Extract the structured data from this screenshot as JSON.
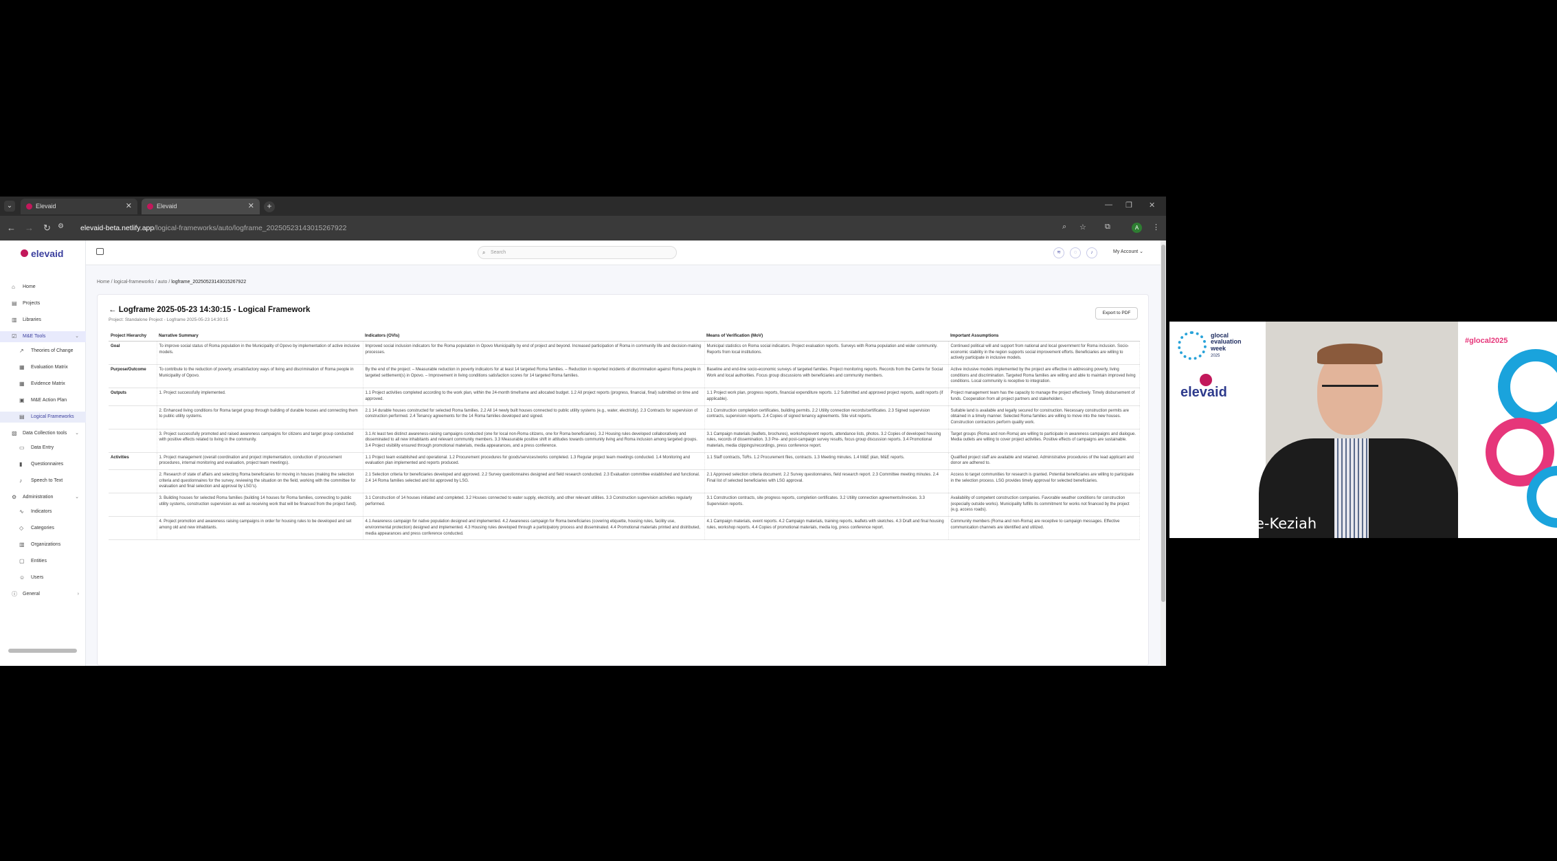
{
  "browser": {
    "tabs": [
      {
        "label": "Elevaid"
      },
      {
        "label": "Elevaid"
      }
    ],
    "url_host": "elevaid-beta.netlify.app",
    "url_path": "/logical-frameworks/auto/logframe_20250523143015267922",
    "profile_initial": "A"
  },
  "app": {
    "logo": "elevaid",
    "search_placeholder": "Search",
    "account_label": "My Account",
    "sidebar": {
      "home": "Home",
      "projects": "Projects",
      "libraries": "Libraries",
      "me_tools": "M&E Tools",
      "theories": "Theories of Change",
      "eval_matrix": "Evaluation Matrix",
      "evidence_matrix": "Evidence Matrix",
      "action_plan": "M&E Action Plan",
      "logical_frameworks": "Logical Frameworks",
      "data_tools": "Data Collection tools",
      "data_entry": "Data Entry",
      "questionnaires": "Questionnaires",
      "speech_to_text": "Speech to Text",
      "administration": "Administration",
      "indicators": "Indicators",
      "categories": "Categories",
      "organizations": "Organizations",
      "entities": "Entities",
      "users": "Users",
      "general": "General"
    },
    "breadcrumb": {
      "home": "Home",
      "sep": "/",
      "lf": "logical-frameworks",
      "auto": "auto",
      "current": "logframe_20250523143015267922"
    },
    "page": {
      "title": "Logframe 2025-05-23 14:30:15 - Logical Framework",
      "subtitle": "Project: Standalone Project - Logframe 2025-05-23 14:30:15",
      "export_label": "Export to PDF"
    },
    "table": {
      "headers": [
        "Project Hierarchy",
        "Narrative Summary",
        "Indicators (OVIs)",
        "Means of Verification (MoV)",
        "Important Assumptions"
      ],
      "rows": [
        {
          "level": "Goal",
          "narrative": "To improve social status of Roma population in the Municipality of Opovo by implementation of active inclusive models.",
          "indicators": "Improved social inclusion indicators for the Roma population in Opovo Municipality by end of project and beyond. Increased participation of Roma in community life and decision-making processes.",
          "mov": "Municipal statistics on Roma social indicators. Project evaluation reports. Surveys with Roma population and wider community. Reports from local institutions.",
          "assumptions": "Continued political will and support from national and local government for Roma inclusion. Socio-economic stability in the region supports social improvement efforts. Beneficiaries are willing to actively participate in inclusive models."
        },
        {
          "level": "Purpose/Outcome",
          "narrative": "To contribute to the reduction of poverty, unsatisfactory ways of living and discrimination of Roma people in Municipality of Opovo.",
          "indicators": "By the end of the project: – Measurable reduction in poverty indicators for at least 14 targeted Roma families. – Reduction in reported incidents of discrimination against Roma people in targeted settlement(s) in Opovo. – Improvement in living conditions satisfaction scores for 14 targeted Roma families.",
          "mov": "Baseline and end-line socio-economic surveys of targeted families. Project monitoring reports. Records from the Centre for Social Work and local authorities. Focus group discussions with beneficiaries and community members.",
          "assumptions": "Active inclusive models implemented by the project are effective in addressing poverty, living conditions and discrimination. Targeted Roma families are willing and able to maintain improved living conditions. Local community is receptive to integration."
        },
        {
          "level": "Outputs",
          "narrative": "1. Project successfully implemented.",
          "indicators": "1.1 Project activities completed according to the work plan, within the 24-month timeframe and allocated budget. 1.2 All project reports (progress, financial, final) submitted on time and approved.",
          "mov": "1.1 Project work plan, progress reports, financial expenditure reports. 1.2 Submitted and approved project reports, audit reports (if applicable).",
          "assumptions": "Project management team has the capacity to manage the project effectively. Timely disbursement of funds. Cooperation from all project partners and stakeholders."
        },
        {
          "level": "",
          "narrative": "2. Enhanced living conditions for Roma target group through building of durable houses and connecting them to public utility systems.",
          "indicators": "2.1 14 durable houses constructed for selected Roma families. 2.2 All 14 newly built houses connected to public utility systems (e.g., water, electricity). 2.3 Contracts for supervision of construction performed. 2.4 Tenancy agreements for the 14 Roma families developed and signed.",
          "mov": "2.1 Construction completion certificates, building permits. 2.2 Utility connection records/certificates. 2.3 Signed supervision contracts, supervision reports. 2.4 Copies of signed tenancy agreements. Site visit reports.",
          "assumptions": "Suitable land is available and legally secured for construction. Necessary construction permits are obtained in a timely manner. Selected Roma families are willing to move into the new houses. Construction contractors perform quality work."
        },
        {
          "level": "",
          "narrative": "3. Project successfully promoted and raised awareness campaigns for citizens and target group conducted with positive effects related to living in the community.",
          "indicators": "3.1 At least two distinct awareness-raising campaigns conducted (one for local non-Roma citizens, one for Roma beneficiaries). 3.2 Housing rules developed collaboratively and disseminated to all new inhabitants and relevant community members. 3.3 Measurable positive shift in attitudes towards community living and Roma inclusion among targeted groups. 3.4 Project visibility ensured through promotional materials, media appearances, and a press conference.",
          "mov": "3.1 Campaign materials (leaflets, brochures), workshop/event reports, attendance lists, photos. 3.2 Copies of developed housing rules, records of dissemination. 3.3 Pre- and post-campaign survey results, focus group discussion reports. 3.4 Promotional materials, media clippings/recordings, press conference report.",
          "assumptions": "Target groups (Roma and non-Roma) are willing to participate in awareness campaigns and dialogue. Media outlets are willing to cover project activities. Positive effects of campaigns are sustainable."
        },
        {
          "level": "Activities",
          "narrative": "1. Project management (overall coordination and project implementation, conduction of procurement procedures, internal monitoring and evaluation, project team meetings).",
          "indicators": "1.1 Project team established and operational. 1.2 Procurement procedures for goods/services/works completed. 1.3 Regular project team meetings conducted. 1.4 Monitoring and evaluation plan implemented and reports produced.",
          "mov": "1.1 Staff contracts, ToRs. 1.2 Procurement files, contracts. 1.3 Meeting minutes. 1.4 M&E plan, M&E reports.",
          "assumptions": "Qualified project staff are available and retained. Administrative procedures of the lead applicant and donor are adhered to."
        },
        {
          "level": "",
          "narrative": "2. Research of state of affairs and selecting Roma beneficiaries for moving in houses (making the selection criteria and questionnaires for the survey, reviewing the situation on the field, working with the committee for evaluation and final selection and approval by LSG's).",
          "indicators": "2.1 Selection criteria for beneficiaries developed and approved. 2.2 Survey questionnaires designed and field research conducted. 2.3 Evaluation committee established and functional. 2.4 14 Roma families selected and list approved by LSG.",
          "mov": "2.1 Approved selection criteria document. 2.2 Survey questionnaires, field research report. 2.3 Committee meeting minutes. 2.4 Final list of selected beneficiaries with LSG approval.",
          "assumptions": "Access to target communities for research is granted. Potential beneficiaries are willing to participate in the selection process. LSG provides timely approval for selected beneficiaries."
        },
        {
          "level": "",
          "narrative": "3. Building houses for selected Roma families (building 14 houses for Roma families, connecting to public utility systems, construction supervision as well as receiving work that will be financed from the project fund).",
          "indicators": "3.1 Construction of 14 houses initiated and completed. 3.2 Houses connected to water supply, electricity, and other relevant utilities. 3.3 Construction supervision activities regularly performed.",
          "mov": "3.1 Construction contracts, site progress reports, completion certificates. 3.2 Utility connection agreements/invoices. 3.3 Supervision reports.",
          "assumptions": "Availability of competent construction companies. Favorable weather conditions for construction (especially outside works). Municipality fulfills its commitment for works not financed by the project (e.g. access roads)."
        },
        {
          "level": "",
          "narrative": "4. Project promotion and awareness raising campaigns in order for housing rules to be developed and set among old and new inhabitants.",
          "indicators": "4.1 Awareness campaign for native population designed and implemented. 4.2 Awareness campaign for Roma beneficiaries (covering etiquette, housing rules, facility use, environmental protection) designed and implemented. 4.3 Housing rules developed through a participatory process and disseminated. 4.4 Promotional materials printed and distributed, media appearances and press conference conducted.",
          "mov": "4.1 Campaign materials, event reports. 4.2 Campaign materials, training reports, leaflets with sketches. 4.3 Draft and final housing rules, workshop reports. 4.4 Copies of promotional materials, media log, press conference report.",
          "assumptions": "Community members (Roma and non-Roma) are receptive to campaign messages. Effective communication channels are identified and utilized."
        }
      ]
    }
  },
  "video": {
    "event_line1": "glocal",
    "event_line2": "evaluation",
    "event_line3": "week",
    "event_year": "2025",
    "hashtag": "#glocal2025",
    "brand": "elevaid",
    "speaker_name": "Paul Thorne-Keziah"
  },
  "colors": {
    "brand_primary": "#3b3f9e",
    "brand_accent": "#c2185b",
    "chrome_dark": "#2b2b2b",
    "hashtag_pink": "#e6367a",
    "swirl_blue": "#1aa3dc"
  }
}
